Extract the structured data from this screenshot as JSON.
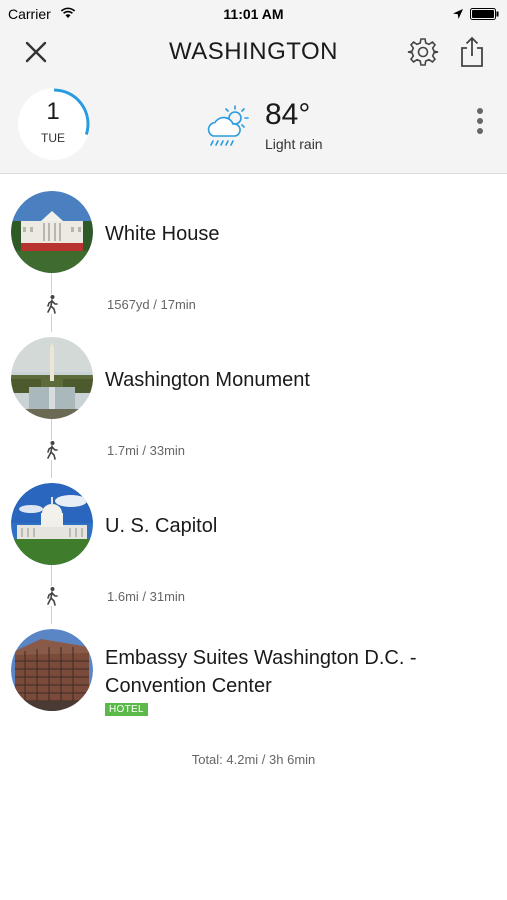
{
  "status_bar": {
    "carrier": "Carrier",
    "time": "11:01 AM"
  },
  "header": {
    "title": "WASHINGTON",
    "icons": [
      "close-icon",
      "settings-gear-icon",
      "share-icon"
    ]
  },
  "day": {
    "number": "1",
    "weekday": "TUE",
    "progress_fraction": 0.3
  },
  "weather": {
    "temperature": "84°",
    "condition": "Light rain",
    "icon": "cloud-sun-rain-icon"
  },
  "stops": [
    {
      "name": "White House",
      "photo": "white-house-photo"
    },
    {
      "name": "Washington Monument",
      "photo": "washington-monument-photo"
    },
    {
      "name": "U. S. Capitol",
      "photo": "us-capitol-photo"
    },
    {
      "name": "Embassy Suites Washington D.C. - Convention Center",
      "badge": "HOTEL",
      "photo": "hotel-photo"
    }
  ],
  "legs": [
    {
      "mode": "walk",
      "text": "1567yd / 17min"
    },
    {
      "mode": "walk",
      "text": "1.7mi / 33min"
    },
    {
      "mode": "walk",
      "text": "1.6mi / 31min"
    }
  ],
  "total": "Total: 4.2mi / 3h 6min",
  "colors": {
    "accent": "#2a9be0",
    "hotel_badge": "#5bb94a",
    "header_bg": "#f4f4f4"
  }
}
